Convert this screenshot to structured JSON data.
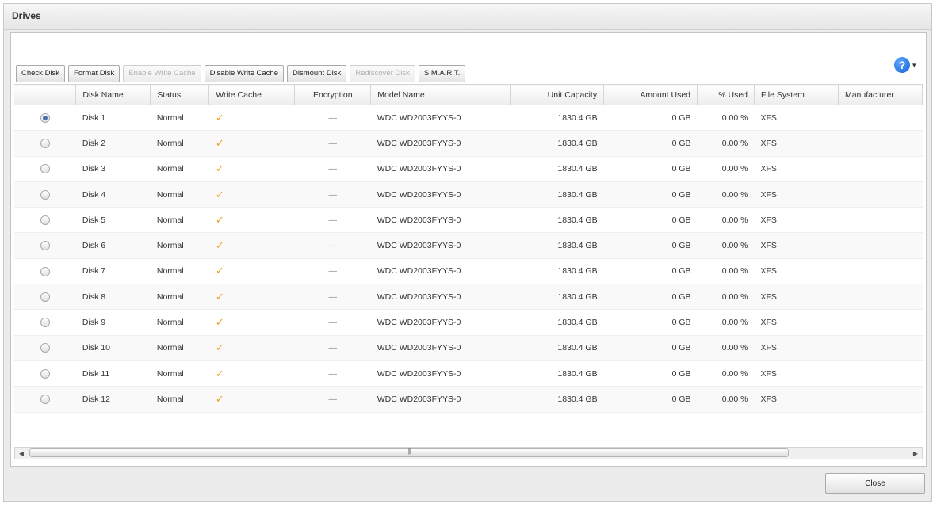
{
  "window": {
    "title": "Drives"
  },
  "help": {
    "icon_label": "?",
    "caret": "▾"
  },
  "toolbar": {
    "buttons": [
      {
        "label": "Check Disk",
        "enabled": true
      },
      {
        "label": "Format Disk",
        "enabled": true
      },
      {
        "label": "Enable Write Cache",
        "enabled": false
      },
      {
        "label": "Disable Write Cache",
        "enabled": true
      },
      {
        "label": "Dismount Disk",
        "enabled": true
      },
      {
        "label": "Rediscover Disk",
        "enabled": false
      },
      {
        "label": "S.M.A.R.T.",
        "enabled": true
      }
    ]
  },
  "table": {
    "columns": [
      "",
      "Disk Name",
      "Status",
      "Write Cache",
      "Encryption",
      "Model Name",
      "Unit Capacity",
      "Amount Used",
      "% Used",
      "File System",
      "Manufacturer"
    ],
    "rows": [
      {
        "selected": true,
        "name": "Disk 1",
        "status": "Normal",
        "write_cache": "✓",
        "encryption": "—",
        "model": "WDC WD2003FYYS-0",
        "capacity": "1830.4 GB",
        "amount_used": "0 GB",
        "pct_used": "0.00 %",
        "fs": "XFS",
        "manufacturer": ""
      },
      {
        "selected": false,
        "name": "Disk 2",
        "status": "Normal",
        "write_cache": "✓",
        "encryption": "—",
        "model": "WDC WD2003FYYS-0",
        "capacity": "1830.4 GB",
        "amount_used": "0 GB",
        "pct_used": "0.00 %",
        "fs": "XFS",
        "manufacturer": ""
      },
      {
        "selected": false,
        "name": "Disk 3",
        "status": "Normal",
        "write_cache": "✓",
        "encryption": "—",
        "model": "WDC WD2003FYYS-0",
        "capacity": "1830.4 GB",
        "amount_used": "0 GB",
        "pct_used": "0.00 %",
        "fs": "XFS",
        "manufacturer": ""
      },
      {
        "selected": false,
        "name": "Disk 4",
        "status": "Normal",
        "write_cache": "✓",
        "encryption": "—",
        "model": "WDC WD2003FYYS-0",
        "capacity": "1830.4 GB",
        "amount_used": "0 GB",
        "pct_used": "0.00 %",
        "fs": "XFS",
        "manufacturer": ""
      },
      {
        "selected": false,
        "name": "Disk 5",
        "status": "Normal",
        "write_cache": "✓",
        "encryption": "—",
        "model": "WDC WD2003FYYS-0",
        "capacity": "1830.4 GB",
        "amount_used": "0 GB",
        "pct_used": "0.00 %",
        "fs": "XFS",
        "manufacturer": ""
      },
      {
        "selected": false,
        "name": "Disk 6",
        "status": "Normal",
        "write_cache": "✓",
        "encryption": "—",
        "model": "WDC WD2003FYYS-0",
        "capacity": "1830.4 GB",
        "amount_used": "0 GB",
        "pct_used": "0.00 %",
        "fs": "XFS",
        "manufacturer": ""
      },
      {
        "selected": false,
        "name": "Disk 7",
        "status": "Normal",
        "write_cache": "✓",
        "encryption": "—",
        "model": "WDC WD2003FYYS-0",
        "capacity": "1830.4 GB",
        "amount_used": "0 GB",
        "pct_used": "0.00 %",
        "fs": "XFS",
        "manufacturer": ""
      },
      {
        "selected": false,
        "name": "Disk 8",
        "status": "Normal",
        "write_cache": "✓",
        "encryption": "—",
        "model": "WDC WD2003FYYS-0",
        "capacity": "1830.4 GB",
        "amount_used": "0 GB",
        "pct_used": "0.00 %",
        "fs": "XFS",
        "manufacturer": ""
      },
      {
        "selected": false,
        "name": "Disk 9",
        "status": "Normal",
        "write_cache": "✓",
        "encryption": "—",
        "model": "WDC WD2003FYYS-0",
        "capacity": "1830.4 GB",
        "amount_used": "0 GB",
        "pct_used": "0.00 %",
        "fs": "XFS",
        "manufacturer": ""
      },
      {
        "selected": false,
        "name": "Disk 10",
        "status": "Normal",
        "write_cache": "✓",
        "encryption": "—",
        "model": "WDC WD2003FYYS-0",
        "capacity": "1830.4 GB",
        "amount_used": "0 GB",
        "pct_used": "0.00 %",
        "fs": "XFS",
        "manufacturer": ""
      },
      {
        "selected": false,
        "name": "Disk 11",
        "status": "Normal",
        "write_cache": "✓",
        "encryption": "—",
        "model": "WDC WD2003FYYS-0",
        "capacity": "1830.4 GB",
        "amount_used": "0 GB",
        "pct_used": "0.00 %",
        "fs": "XFS",
        "manufacturer": ""
      },
      {
        "selected": false,
        "name": "Disk 12",
        "status": "Normal",
        "write_cache": "✓",
        "encryption": "—",
        "model": "WDC WD2003FYYS-0",
        "capacity": "1830.4 GB",
        "amount_used": "0 GB",
        "pct_used": "0.00 %",
        "fs": "XFS",
        "manufacturer": ""
      }
    ]
  },
  "scrollbar": {
    "left_arrow": "◀",
    "right_arrow": "▶",
    "grip": "|||"
  },
  "footer": {
    "close_label": "Close"
  }
}
